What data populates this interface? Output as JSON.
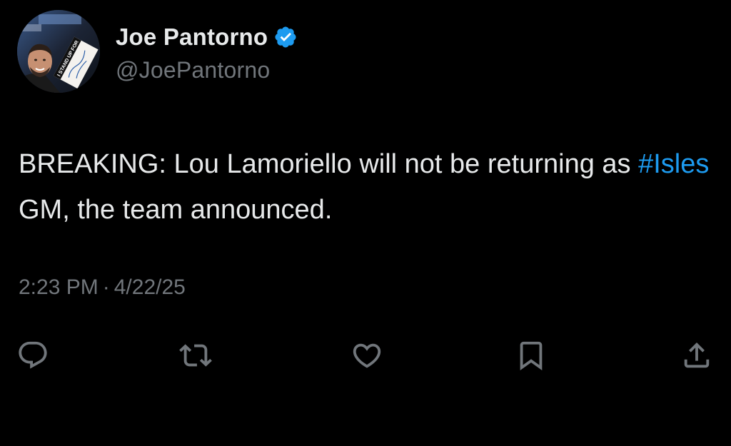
{
  "author": {
    "display_name": "Joe Pantorno",
    "handle": "@JoePantorno",
    "verified": true,
    "avatar_sign_text": "I STAND UP FOR"
  },
  "tweet": {
    "text_before": "BREAKING: Lou Lamoriello will not be returning as ",
    "hashtag": "#Isles",
    "text_after": " GM, the team announced.",
    "time": "2:23 PM",
    "separator": "·",
    "date": "4/22/25"
  },
  "actions": [
    "reply-icon",
    "retweet-icon",
    "like-icon",
    "bookmark-icon",
    "share-icon"
  ],
  "colors": {
    "background": "#000000",
    "text": "#e7e9ea",
    "secondary": "#71767b",
    "accent": "#1d9bf0"
  }
}
